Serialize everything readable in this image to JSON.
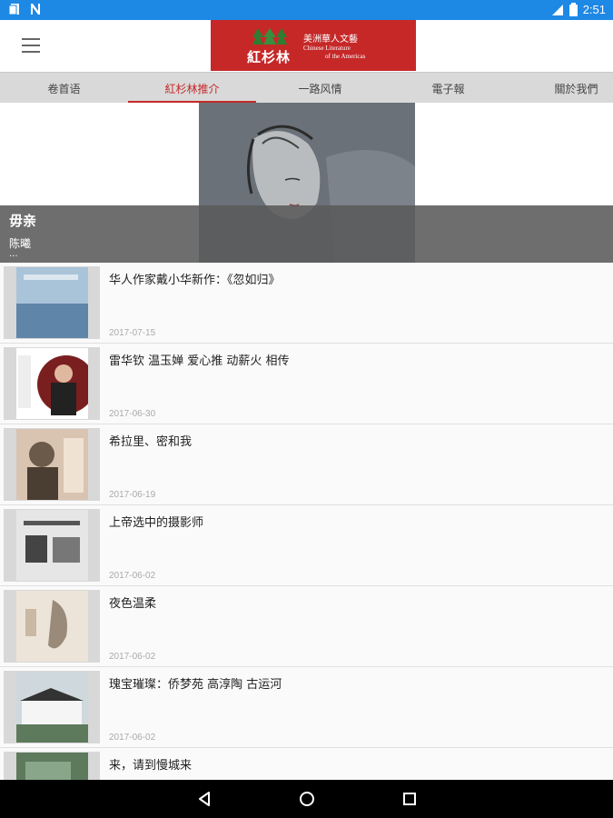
{
  "status_bar": {
    "time": "2:51"
  },
  "header": {
    "logo_main": "紅杉林",
    "logo_sub_cn": "美洲華人文藝",
    "logo_sub_en1": "Chinese Literature",
    "logo_sub_en2": "of the Americas"
  },
  "tabs": [
    {
      "label": "卷首语"
    },
    {
      "label": "紅杉林推介"
    },
    {
      "label": "一路风情"
    },
    {
      "label": "電子報"
    },
    {
      "label": "關於我們"
    }
  ],
  "hero": {
    "title": "毋亲",
    "author": "陈曦",
    "more": "..."
  },
  "articles": [
    {
      "title": "华人作家戴小华新作：《忽如归》",
      "date": "2017-07-15"
    },
    {
      "title": "雷华钦 温玉婵 爱心推 动薪火 相传",
      "date": "2017-06-30"
    },
    {
      "title": "希拉里、密和我",
      "date": "2017-06-19"
    },
    {
      "title": "上帝选中的摄影师",
      "date": "2017-06-02"
    },
    {
      "title": "夜色温柔",
      "date": "2017-06-02"
    },
    {
      "title": "瑰宝璀璨：侨梦苑 高淳陶 古运河",
      "date": "2017-06-02"
    },
    {
      "title": "来，请到慢城来",
      "date": ""
    }
  ],
  "colors": {
    "status": "#1e88e5",
    "brand": "#c62828",
    "tabs_bg": "#d9d9d9"
  }
}
